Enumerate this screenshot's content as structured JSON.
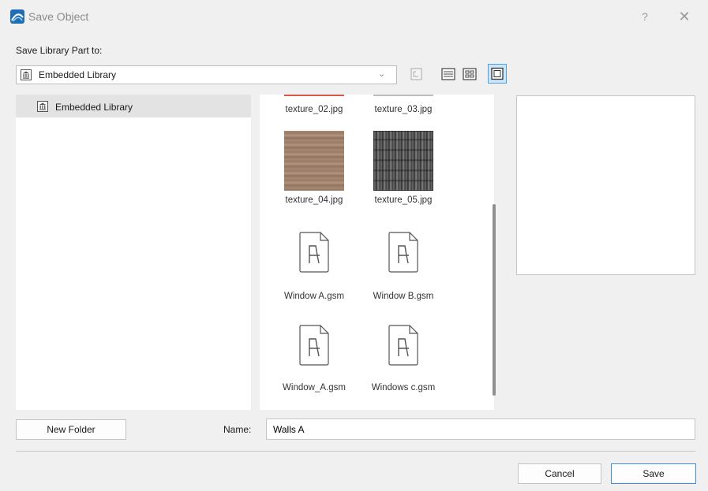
{
  "window": {
    "title": "Save Object",
    "help_glyph": "?",
    "close_glyph": "✕",
    "icon": "archicad-app-icon"
  },
  "location": {
    "label": "Save Library Part to:",
    "selected": "Embedded Library",
    "icon": "library-icon"
  },
  "toolbar": {
    "parent_folder_icon": "parent-folder-icon",
    "list_view_icon": "list-view-icon",
    "grid_view_icon": "grid-view-icon",
    "preview_view_icon": "preview-view-icon",
    "active_view": "preview"
  },
  "folder_tree": {
    "items": [
      {
        "label": "Embedded Library",
        "icon": "library-icon",
        "selected": true
      }
    ]
  },
  "files": [
    {
      "name": "texture_02.jpg",
      "kind": "image"
    },
    {
      "name": "texture_03.jpg",
      "kind": "image"
    },
    {
      "name": "texture_04.jpg",
      "kind": "image"
    },
    {
      "name": "texture_05.jpg",
      "kind": "image"
    },
    {
      "name": "Window A.gsm",
      "kind": "object"
    },
    {
      "name": "Window B.gsm",
      "kind": "object"
    },
    {
      "name": "Window_A.gsm",
      "kind": "object"
    },
    {
      "name": "Windows c.gsm",
      "kind": "object"
    }
  ],
  "actions": {
    "new_folder": "New Folder",
    "cancel": "Cancel",
    "save": "Save"
  },
  "name_field": {
    "label": "Name:",
    "value": "Walls A"
  },
  "colors": {
    "accent": "#3c8fd8",
    "active_toggle_bg": "#cde6fb"
  }
}
